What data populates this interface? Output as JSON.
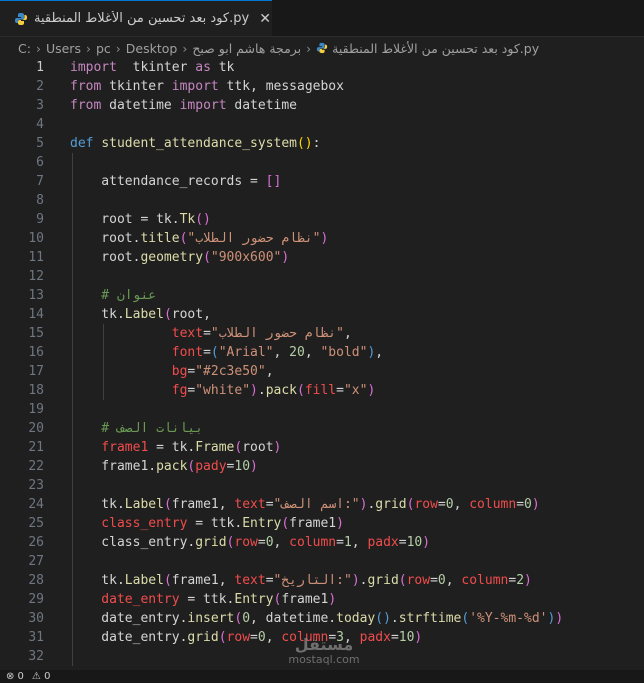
{
  "tab": {
    "label": "كود بعد تحسين من الأغلاط المنطقية.py",
    "close": "✕",
    "icon": "python-file-icon"
  },
  "breadcrumb": [
    "C:",
    "Users",
    "pc",
    "Desktop",
    "برمجة هاشم ابو صبح",
    "كود بعد تحسين من الأغلاط المنطقية.py"
  ],
  "status": {
    "errors": "⊗ 0",
    "warnings": "⚠ 0"
  },
  "watermark": {
    "arabic": "مستقل",
    "latin": "mostaql.com"
  },
  "code_lines": [
    {
      "n": "1",
      "t": [
        [
          "kw2",
          "import"
        ],
        [
          "",
          "  tkinter "
        ],
        [
          "kw2",
          "as"
        ],
        [
          "",
          " tk"
        ]
      ]
    },
    {
      "n": "2",
      "t": [
        [
          "kw2",
          "from"
        ],
        [
          "",
          " tkinter "
        ],
        [
          "kw2",
          "import"
        ],
        [
          "",
          " ttk, messagebox"
        ]
      ]
    },
    {
      "n": "3",
      "t": [
        [
          "kw2",
          "from"
        ],
        [
          "",
          " datetime "
        ],
        [
          "kw2",
          "import"
        ],
        [
          "",
          " datetime"
        ]
      ]
    },
    {
      "n": "4",
      "t": []
    },
    {
      "n": "5",
      "t": [
        [
          "kw",
          "def"
        ],
        [
          "",
          " "
        ],
        [
          "fn",
          "student_attendance_system"
        ],
        [
          "pu",
          "()"
        ],
        [
          "",
          ":"
        ]
      ]
    },
    {
      "n": "6",
      "t": []
    },
    {
      "n": "7",
      "t": [
        [
          "",
          "    attendance_records = "
        ],
        [
          "pu2",
          "[]"
        ]
      ]
    },
    {
      "n": "8",
      "t": []
    },
    {
      "n": "9",
      "t": [
        [
          "",
          "    root = tk."
        ],
        [
          "fn",
          "Tk"
        ],
        [
          "pu2",
          "()"
        ]
      ]
    },
    {
      "n": "10",
      "t": [
        [
          "",
          "    root."
        ],
        [
          "fn",
          "title"
        ],
        [
          "pu2",
          "("
        ],
        [
          "st",
          "\"نظام حضور الطلاب\""
        ],
        [
          "pu2",
          ")"
        ]
      ]
    },
    {
      "n": "11",
      "t": [
        [
          "",
          "    root."
        ],
        [
          "fn",
          "geometry"
        ],
        [
          "pu2",
          "("
        ],
        [
          "st",
          "\"900x600\""
        ],
        [
          "pu2",
          ")"
        ]
      ]
    },
    {
      "n": "12",
      "t": []
    },
    {
      "n": "13",
      "t": [
        [
          "cm",
          "    # عنوان"
        ]
      ]
    },
    {
      "n": "14",
      "t": [
        [
          "",
          "    tk."
        ],
        [
          "fn",
          "Label"
        ],
        [
          "pu2",
          "("
        ],
        [
          "",
          "root,"
        ]
      ]
    },
    {
      "n": "15",
      "t": [
        [
          "",
          "             "
        ],
        [
          "var",
          "text"
        ],
        [
          "",
          "="
        ],
        [
          "st",
          "\"نظام حضور الطلاب\""
        ],
        [
          "",
          ","
        ]
      ]
    },
    {
      "n": "16",
      "t": [
        [
          "",
          "             "
        ],
        [
          "var",
          "font"
        ],
        [
          "",
          "="
        ],
        [
          "kw",
          "("
        ],
        [
          "st",
          "\"Arial\""
        ],
        [
          "",
          ", "
        ],
        [
          "nu",
          "20"
        ],
        [
          "",
          ", "
        ],
        [
          "st",
          "\"bold\""
        ],
        [
          "kw",
          ")"
        ],
        [
          "",
          ","
        ]
      ]
    },
    {
      "n": "17",
      "t": [
        [
          "",
          "             "
        ],
        [
          "var",
          "bg"
        ],
        [
          "",
          "="
        ],
        [
          "st",
          "\"#2c3e50\""
        ],
        [
          "",
          ","
        ]
      ]
    },
    {
      "n": "18",
      "t": [
        [
          "",
          "             "
        ],
        [
          "var",
          "fg"
        ],
        [
          "",
          "="
        ],
        [
          "st",
          "\"white\""
        ],
        [
          "pu2",
          ")"
        ],
        [
          "",
          "."
        ],
        [
          "fn",
          "pack"
        ],
        [
          "pu2",
          "("
        ],
        [
          "var",
          "fill"
        ],
        [
          "",
          "="
        ],
        [
          "st",
          "\"x\""
        ],
        [
          "pu2",
          ")"
        ]
      ]
    },
    {
      "n": "19",
      "t": []
    },
    {
      "n": "20",
      "t": [
        [
          "cm",
          "    # بيانات الصف"
        ]
      ]
    },
    {
      "n": "21",
      "t": [
        [
          "var",
          "    frame1"
        ],
        [
          "",
          " = tk."
        ],
        [
          "fn",
          "Frame"
        ],
        [
          "pu2",
          "("
        ],
        [
          "",
          "root"
        ],
        [
          "pu2",
          ")"
        ]
      ]
    },
    {
      "n": "22",
      "t": [
        [
          "",
          "    frame1."
        ],
        [
          "fn",
          "pack"
        ],
        [
          "pu2",
          "("
        ],
        [
          "var",
          "pady"
        ],
        [
          "",
          "="
        ],
        [
          "nu",
          "10"
        ],
        [
          "pu2",
          ")"
        ]
      ]
    },
    {
      "n": "23",
      "t": []
    },
    {
      "n": "24",
      "t": [
        [
          "",
          "    tk."
        ],
        [
          "fn",
          "Label"
        ],
        [
          "pu2",
          "("
        ],
        [
          "",
          "frame1, "
        ],
        [
          "var",
          "text"
        ],
        [
          "",
          "="
        ],
        [
          "st",
          "\"اسم الصف:\""
        ],
        [
          "pu2",
          ")"
        ],
        [
          "",
          "."
        ],
        [
          "fn",
          "grid"
        ],
        [
          "pu2",
          "("
        ],
        [
          "var",
          "row"
        ],
        [
          "",
          "="
        ],
        [
          "nu",
          "0"
        ],
        [
          "",
          ", "
        ],
        [
          "var",
          "column"
        ],
        [
          "",
          "="
        ],
        [
          "nu",
          "0"
        ],
        [
          "pu2",
          ")"
        ]
      ]
    },
    {
      "n": "25",
      "t": [
        [
          "var",
          "    class_entry"
        ],
        [
          "",
          " = ttk."
        ],
        [
          "fn",
          "Entry"
        ],
        [
          "pu2",
          "("
        ],
        [
          "",
          "frame1"
        ],
        [
          "pu2",
          ")"
        ]
      ]
    },
    {
      "n": "26",
      "t": [
        [
          "",
          "    class_entry."
        ],
        [
          "fn",
          "grid"
        ],
        [
          "pu2",
          "("
        ],
        [
          "var",
          "row"
        ],
        [
          "",
          "="
        ],
        [
          "nu",
          "0"
        ],
        [
          "",
          ", "
        ],
        [
          "var",
          "column"
        ],
        [
          "",
          "="
        ],
        [
          "nu",
          "1"
        ],
        [
          "",
          ", "
        ],
        [
          "var",
          "padx"
        ],
        [
          "",
          "="
        ],
        [
          "nu",
          "10"
        ],
        [
          "pu2",
          ")"
        ]
      ]
    },
    {
      "n": "27",
      "t": []
    },
    {
      "n": "28",
      "t": [
        [
          "",
          "    tk."
        ],
        [
          "fn",
          "Label"
        ],
        [
          "pu2",
          "("
        ],
        [
          "",
          "frame1, "
        ],
        [
          "var",
          "text"
        ],
        [
          "",
          "="
        ],
        [
          "st",
          "\"التاريخ:\""
        ],
        [
          "pu2",
          ")"
        ],
        [
          "",
          "."
        ],
        [
          "fn",
          "grid"
        ],
        [
          "pu2",
          "("
        ],
        [
          "var",
          "row"
        ],
        [
          "",
          "="
        ],
        [
          "nu",
          "0"
        ],
        [
          "",
          ", "
        ],
        [
          "var",
          "column"
        ],
        [
          "",
          "="
        ],
        [
          "nu",
          "2"
        ],
        [
          "pu2",
          ")"
        ]
      ]
    },
    {
      "n": "29",
      "t": [
        [
          "var",
          "    date_entry"
        ],
        [
          "",
          " = ttk."
        ],
        [
          "fn",
          "Entry"
        ],
        [
          "pu2",
          "("
        ],
        [
          "",
          "frame1"
        ],
        [
          "pu2",
          ")"
        ]
      ]
    },
    {
      "n": "30",
      "t": [
        [
          "",
          "    date_entry."
        ],
        [
          "fn",
          "insert"
        ],
        [
          "pu2",
          "("
        ],
        [
          "nu",
          "0"
        ],
        [
          "",
          ", datetime."
        ],
        [
          "fn",
          "today"
        ],
        [
          "kw",
          "()"
        ],
        [
          "",
          "."
        ],
        [
          "fn",
          "strftime"
        ],
        [
          "kw",
          "("
        ],
        [
          "st",
          "'%Y-%m-%d'"
        ],
        [
          "kw",
          ")"
        ],
        [
          "pu2",
          ")"
        ]
      ]
    },
    {
      "n": "31",
      "t": [
        [
          "",
          "    date_entry."
        ],
        [
          "fn",
          "grid"
        ],
        [
          "pu2",
          "("
        ],
        [
          "var",
          "row"
        ],
        [
          "",
          "="
        ],
        [
          "nu",
          "0"
        ],
        [
          "",
          ", "
        ],
        [
          "var",
          "column"
        ],
        [
          "",
          "="
        ],
        [
          "nu",
          "3"
        ],
        [
          "",
          ", "
        ],
        [
          "var",
          "padx"
        ],
        [
          "",
          "="
        ],
        [
          "nu",
          "10"
        ],
        [
          "pu2",
          ")"
        ]
      ]
    },
    {
      "n": "32",
      "t": []
    }
  ]
}
